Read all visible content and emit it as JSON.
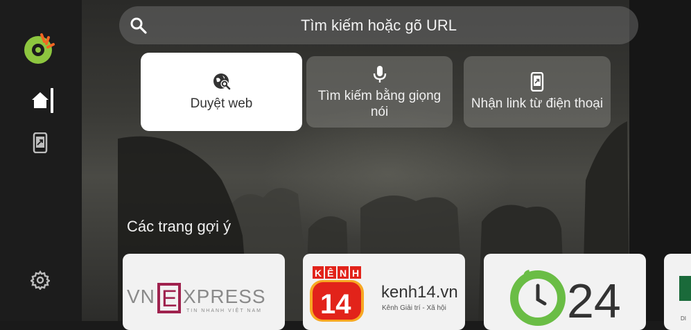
{
  "search": {
    "placeholder": "Tìm kiếm hoặc gõ URL",
    "icon": "search-icon"
  },
  "sidebar": {
    "items": [
      {
        "name": "home",
        "icon": "home-icon",
        "active": true
      },
      {
        "name": "phone-link",
        "icon": "phone-link-icon",
        "active": false
      },
      {
        "name": "settings",
        "icon": "gear-icon",
        "active": false
      }
    ]
  },
  "actions": [
    {
      "label": "Duyệt web",
      "icon": "globe-search-icon",
      "active": true
    },
    {
      "label": "Tìm kiếm bằng giọng nói",
      "icon": "microphone-icon",
      "active": false
    },
    {
      "label": "Nhận link từ điện thoại",
      "icon": "phone-link-icon",
      "active": false
    }
  ],
  "suggested": {
    "title": "Các trang gợi ý",
    "sites": [
      {
        "name": "VnExpress",
        "logo_text": "VNEXPRESS",
        "tagline": "TIN NHANH VIỆT NAM"
      },
      {
        "name": "kenh14.vn",
        "logo_text": "kenh14.vn",
        "tagline": "Kênh Giải trí - Xã hội",
        "badge_top": "KÊNH",
        "badge_num": "14"
      },
      {
        "name": "24h",
        "logo_text": "24h"
      },
      {
        "name": "partial-tile",
        "logo_text": "DI"
      }
    ]
  },
  "colors": {
    "accent_green": "#8dc63f",
    "accent_orange": "#f26522",
    "vnexpress_red": "#9f224e",
    "kenh14_red": "#e2231a"
  }
}
